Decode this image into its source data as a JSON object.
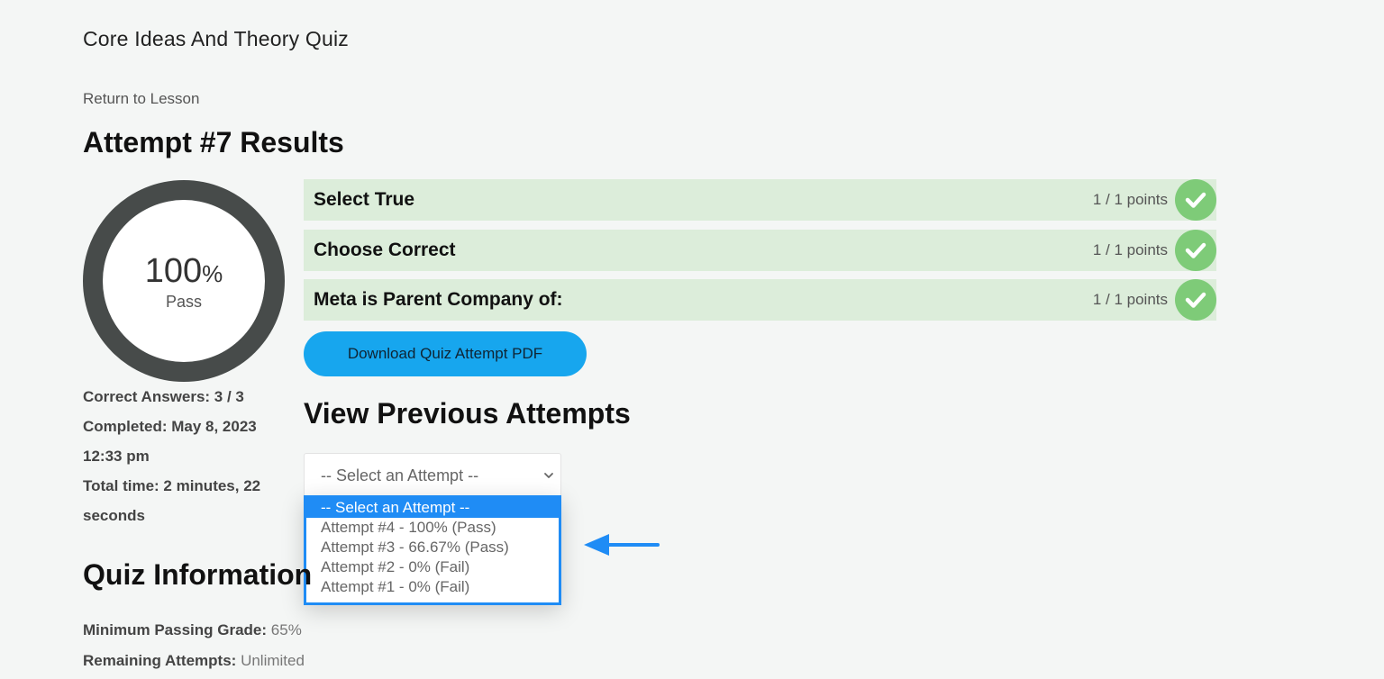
{
  "quiz_title": "Core Ideas And Theory Quiz",
  "return_link": "Return to Lesson",
  "results_heading": "Attempt #7 Results",
  "score": {
    "value": "100",
    "unit": "%",
    "label": "Pass"
  },
  "stats": {
    "correct_answers": "Correct Answers: 3 / 3",
    "completed": "Completed: May 8, 2023 12:33 pm",
    "total_time": "Total time: 2 minutes, 22 seconds"
  },
  "questions": [
    {
      "title": "Select True",
      "points": "1 / 1 points"
    },
    {
      "title": "Choose Correct",
      "points": "1 / 1 points"
    },
    {
      "title": "Meta is Parent Company of:",
      "points": "1 / 1 points"
    }
  ],
  "download_button": "Download Quiz Attempt PDF",
  "previous_attempts": {
    "heading": "View Previous Attempts",
    "select_value": "-- Select an Attempt --",
    "options": [
      "-- Select an Attempt --",
      "Attempt #4 - 100% (Pass)",
      "Attempt #3 - 66.67% (Pass)",
      "Attempt #2 - 0% (Fail)",
      "Attempt #1 - 0% (Fail)"
    ]
  },
  "quiz_info": {
    "heading": "Quiz Information",
    "min_passing_label": "Minimum Passing Grade:",
    "min_passing_value": "65%",
    "remaining_label": "Remaining Attempts:",
    "remaining_value": "Unlimited"
  },
  "icons": {
    "check": "check-circle-icon",
    "chevron": "chevron-down-icon",
    "arrow": "arrow-left-icon"
  },
  "colors": {
    "correct_bg": "#dcedda",
    "check": "#7ecb78",
    "accent": "#17a6ee",
    "select_highlight": "#1f8cf5",
    "ring": "#474b4a"
  }
}
